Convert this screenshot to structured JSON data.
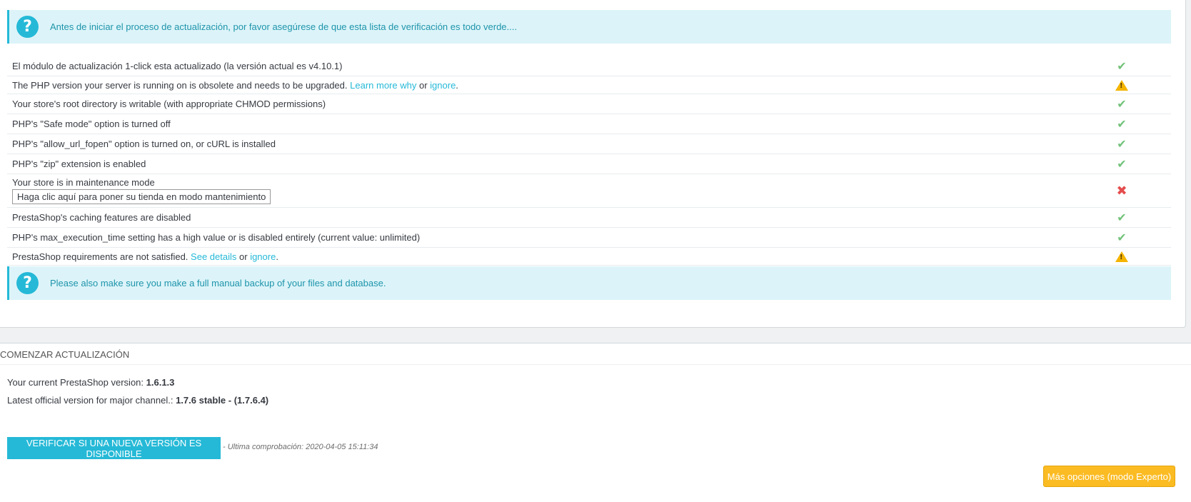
{
  "alert_top": {
    "text": "Antes de iniciar el proceso de actualización, por favor asegúrese de que esta lista de verificación es todo verde...."
  },
  "checklist": {
    "rows": [
      {
        "text": "El módulo de actualización 1-click esta actualizado (la versión actual es v4.10.1)",
        "status": "ok"
      },
      {
        "text_before": "The PHP version your server is running on is obsolete and needs to be upgraded.",
        "link1": "Learn more why",
        "mid": "or",
        "link2": "ignore",
        "end": ".",
        "status": "warning"
      },
      {
        "text": "Your store's root directory is writable (with appropriate CHMOD permissions)",
        "status": "ok"
      },
      {
        "text": "PHP's \"Safe mode\" option is turned off",
        "status": "ok"
      },
      {
        "text": "PHP's \"allow_url_fopen\" option is turned on, or cURL is installed",
        "status": "ok"
      },
      {
        "text": "PHP's \"zip\" extension is enabled",
        "status": "ok"
      },
      {
        "text": "Your store is in maintenance mode",
        "button": "Haga clic aquí para poner su tienda en modo mantenimiento",
        "status": "error"
      },
      {
        "text": "PrestaShop's caching features are disabled",
        "status": "ok"
      },
      {
        "text": "PHP's max_execution_time setting has a high value or is disabled entirely (current value: unlimited)",
        "status": "ok"
      },
      {
        "text_before": "PrestaShop requirements are not satisfied.",
        "link1": "See details",
        "mid": "or",
        "link2": "ignore",
        "end": ".",
        "status": "warning"
      }
    ]
  },
  "alert_bottom": {
    "text": "Please also make sure you make a full manual backup of your files and database."
  },
  "upgrade": {
    "heading": "COMENZAR ACTUALIZACIÓN",
    "current_label": "Your current PrestaShop version:",
    "current_value": "1.6.1.3",
    "latest_label": "Latest official version for major channel.:",
    "latest_value": "1.7.6 stable - (1.7.6.4)",
    "check_button": "VERIFICAR SI UNA NUEVA VERSIÓN ES DISPONIBLE",
    "last_check": "- Ultima comprobación: 2020-04-05 15:11:34",
    "expert_button": "Más opciones (modo Experto)"
  },
  "icons": {
    "ok": "✔",
    "error": "✖",
    "warning": "!",
    "question": "?"
  },
  "colors": {
    "accent": "#25b9d7",
    "ok": "#72c279",
    "error": "#e54c4c",
    "warning": "#f4b400",
    "expert": "#fbbb22"
  }
}
